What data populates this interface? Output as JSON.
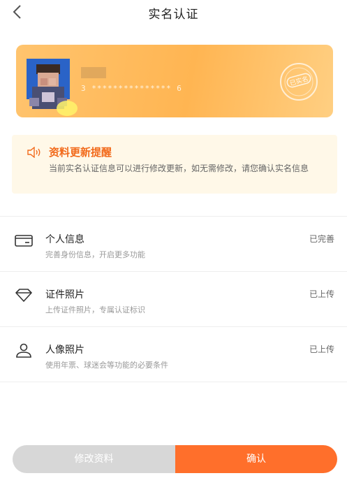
{
  "header": {
    "title": "实名认证",
    "back_icon": "chevron-left-icon"
  },
  "id_card": {
    "number_masked": "3 *************** 6",
    "stamp_text": "已实名",
    "colors": {
      "gradient_start": "#ffc46e",
      "gradient_end": "#ffcf82"
    }
  },
  "notice": {
    "icon": "speaker-icon",
    "title": "资料更新提醒",
    "text": "当前实名认证信息可以进行修改更新，如无需修改，请您确认实名信息"
  },
  "items": [
    {
      "icon": "card-icon",
      "title": "个人信息",
      "desc": "完善身份信息，开启更多功能",
      "status": "已完善"
    },
    {
      "icon": "diamond-icon",
      "title": "证件照片",
      "desc": "上传证件照片，专属认证标识",
      "status": "已上传"
    },
    {
      "icon": "user-icon",
      "title": "人像照片",
      "desc": "使用年票、球迷会等功能的必要条件",
      "status": "已上传"
    }
  ],
  "footer": {
    "modify_label": "修改资料",
    "confirm_label": "确认"
  },
  "colors": {
    "accent": "#ff6f2b",
    "notice_title": "#f26a1b",
    "disabled": "#d7d7d7"
  }
}
